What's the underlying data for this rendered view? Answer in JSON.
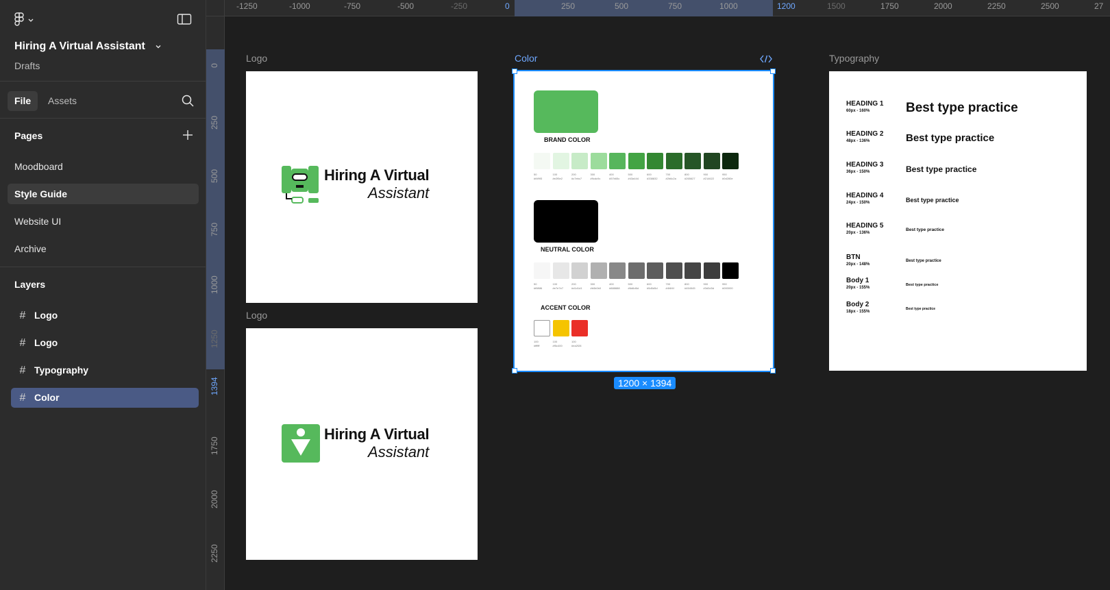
{
  "file": {
    "title": "Hiring A Virtual Assistant",
    "location": "Drafts"
  },
  "tabs": {
    "file": "File",
    "assets": "Assets"
  },
  "pages": {
    "title": "Pages",
    "items": [
      "Moodboard",
      "Style Guide",
      "Website UI",
      "Archive"
    ],
    "active": "Style Guide"
  },
  "layers": {
    "title": "Layers",
    "items": [
      "Logo",
      "Logo",
      "Typography",
      "Color"
    ],
    "active": "Color"
  },
  "ruler": {
    "top": [
      "-1250",
      "-1000",
      "-750",
      "-500",
      "-250",
      "0",
      "250",
      "500",
      "750",
      "1000",
      "1200",
      "1500",
      "1750",
      "2000",
      "2250",
      "2500",
      "27"
    ],
    "left": [
      "0",
      "250",
      "500",
      "750",
      "1000",
      "1250",
      "1394",
      "1750",
      "2000",
      "2250"
    ]
  },
  "frames": {
    "logo1_label": "Logo",
    "logo2_label": "Logo",
    "color_label": "Color",
    "typography_label": "Typography",
    "dimensions": "1200 × 1394"
  },
  "logo": {
    "line1": "Hiring A Virtual",
    "line2": "Assistant"
  },
  "colors": {
    "brand": {
      "heading": "BRAND COLOR",
      "main": "#56b95c",
      "chips": [
        {
          "step": "50",
          "hex": "#f4f9f3",
          "code": "#f4f9f3"
        },
        {
          "step": "100",
          "hex": "#e2f5e2",
          "code": "#e2f5e2"
        },
        {
          "step": "200",
          "hex": "#c7ebc7",
          "code": "#c7ebc7"
        },
        {
          "step": "300",
          "hex": "#9cdc9c",
          "code": "#9cdc9c"
        },
        {
          "step": "400",
          "hex": "#57b65c",
          "code": "#57b65c"
        },
        {
          "step": "500",
          "hex": "#43a444",
          "code": "#43a444"
        },
        {
          "step": "600",
          "hex": "#338832",
          "code": "#338832"
        },
        {
          "step": "700",
          "hex": "#2b6c2a",
          "code": "#2b6c2a"
        },
        {
          "step": "800",
          "hex": "#265627",
          "code": "#265627"
        },
        {
          "step": "900",
          "hex": "#214622",
          "code": "#214622"
        },
        {
          "step": "950",
          "hex": "#0d280e",
          "code": "#0d280e"
        }
      ]
    },
    "neutral": {
      "heading": "NEUTRAL COLOR",
      "main": "#000000",
      "chips": [
        {
          "step": "50",
          "hex": "#f6f6f6",
          "code": "#f6f6f6"
        },
        {
          "step": "100",
          "hex": "#e7e7e7",
          "code": "#e7e7e7"
        },
        {
          "step": "200",
          "hex": "#d1d1d1",
          "code": "#d1d1d1"
        },
        {
          "step": "300",
          "hex": "#b0b0b0",
          "code": "#b0b0b0"
        },
        {
          "step": "400",
          "hex": "#888888",
          "code": "#888888"
        },
        {
          "step": "500",
          "hex": "#6d6d6d",
          "code": "#6d6d6d"
        },
        {
          "step": "600",
          "hex": "#5d5d5d",
          "code": "#5d5d5d"
        },
        {
          "step": "700",
          "hex": "#4f4f4f",
          "code": "#4f4f4f"
        },
        {
          "step": "800",
          "hex": "#454545",
          "code": "#454545"
        },
        {
          "step": "900",
          "hex": "#3d3d3d",
          "code": "#3d3d3d"
        },
        {
          "step": "950",
          "hex": "#000000",
          "code": "#000000"
        }
      ]
    },
    "accent": {
      "heading": "ACCENT COLOR",
      "chips": [
        {
          "step": "100",
          "hex": "#ffffff",
          "code": "#ffffff"
        },
        {
          "step": "100",
          "hex": "#f5c400",
          "code": "#f5c400"
        },
        {
          "step": "100",
          "hex": "#ea2f28",
          "code": "#ea2f28"
        }
      ]
    }
  },
  "typography": {
    "rows": [
      {
        "name": "HEADING 1",
        "spec": "60px - 160%",
        "sample": "Best type practice"
      },
      {
        "name": "HEADING 2",
        "spec": "48px - 136%",
        "sample": "Best type practice"
      },
      {
        "name": "HEADING 3",
        "spec": "36px - 150%",
        "sample": "Best type practice"
      },
      {
        "name": "HEADING 4",
        "spec": "24px - 150%",
        "sample": "Best type practice"
      },
      {
        "name": "HEADING 5",
        "spec": "20px - 136%",
        "sample": "Best type practice"
      },
      {
        "name": "BTN",
        "spec": "20px - 148%",
        "sample": "Best type practice"
      },
      {
        "name": "Body 1",
        "spec": "20px - 155%",
        "sample": "Best type practice"
      },
      {
        "name": "Body 2",
        "spec": "18px - 155%",
        "sample": "Best type practice"
      }
    ]
  },
  "icons": {
    "figma_menu": "figma-logo-icon",
    "sidebar_toggle": "sidebar-toggle-icon",
    "search": "search-icon",
    "add": "plus-icon",
    "frame": "hash-icon",
    "code": "code-icon"
  },
  "accent_color": "#1a8cff",
  "selection_color": "#4a5a85"
}
